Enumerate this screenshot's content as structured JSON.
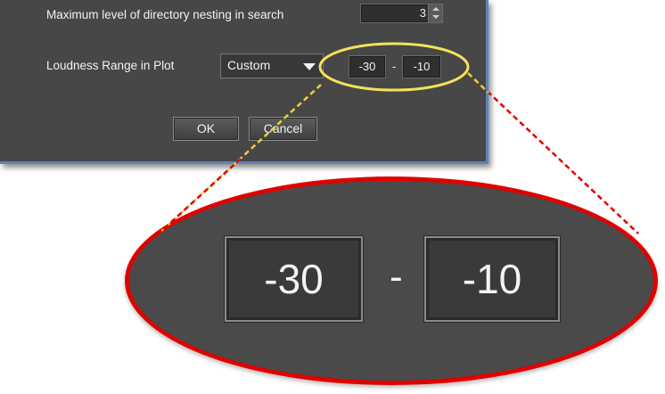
{
  "dialog": {
    "nesting_label": "Maximum level of directory nesting in search",
    "nesting_value": "3",
    "loudness_label": "Loudness Range in Plot",
    "loudness_mode": "Custom",
    "range_min": "-30",
    "range_separator": "-",
    "range_max": "-10",
    "ok_label": "OK",
    "cancel_label": "Cancel"
  },
  "zoom": {
    "range_min": "-30",
    "range_separator": "-",
    "range_max": "-10"
  },
  "colors": {
    "dialog_bg": "#474747",
    "dialog_border": "#5a84b8",
    "highlight_ellipse": "#f2e35a",
    "zoom_outline": "#e00000"
  }
}
